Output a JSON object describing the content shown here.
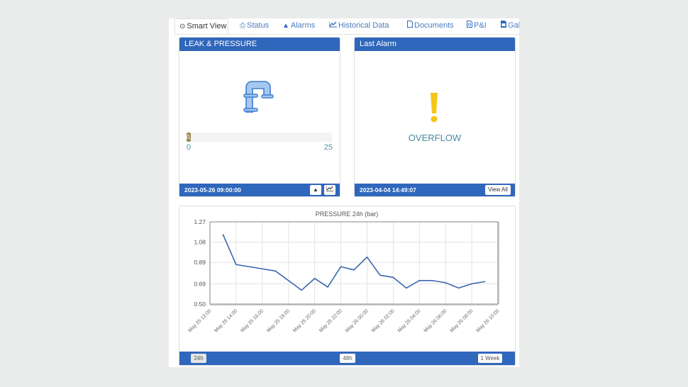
{
  "tabs": [
    {
      "label": "Smart View",
      "icon": "clock-icon",
      "glyph": "⊙",
      "active": true
    },
    {
      "label": "Status",
      "icon": "printer-icon",
      "glyph": "⎙",
      "active": false
    },
    {
      "label": "Alarms",
      "icon": "warning-icon",
      "glyph": "▲",
      "active": false
    },
    {
      "label": "Historical Data",
      "icon": "line-chart-icon",
      "glyph": "📈",
      "active": false
    },
    {
      "label": "Documents",
      "icon": "file-icon",
      "glyph": "🗋",
      "active": false
    },
    {
      "label": "P&I",
      "icon": "pdf-file-icon",
      "glyph": "🗎",
      "active": false
    },
    {
      "label": "Galle",
      "icon": "image-file-icon",
      "glyph": "🖻",
      "active": false
    }
  ],
  "leak_panel": {
    "title": "LEAK & PRESSURE",
    "icon": "pipe-icon",
    "bar": {
      "value": 0.71,
      "value_label": "0.71",
      "min": 0,
      "max": 25,
      "min_label": "0",
      "max_label": "25"
    },
    "timestamp": "2023-05-26 09:00:00",
    "buttons": [
      {
        "name": "alarm-button",
        "icon": "warning-icon",
        "glyph": "▲"
      },
      {
        "name": "chart-button",
        "icon": "line-chart-icon",
        "glyph": "⟋"
      }
    ]
  },
  "alarm_panel": {
    "title": "Last Alarm",
    "icon": "exclamation-icon",
    "alarm_text": "OVERFLOW",
    "timestamp": "2023-04-04 14:49:07",
    "view_all_label": "View All"
  },
  "range_buttons": [
    {
      "label": "24h",
      "active": true
    },
    {
      "label": "48h",
      "active": false
    },
    {
      "label": "1 Week",
      "active": false
    }
  ],
  "colors": {
    "accent": "#2f67bc",
    "line": "#3a66ad",
    "alarm": "#f5c518"
  },
  "chart_data": {
    "type": "line",
    "title": "PRESSURE 24h (bar)",
    "xlabel": "",
    "ylabel": "",
    "ylim": [
      0.5,
      1.27
    ],
    "yticks": [
      "0.50",
      "0.69",
      "0.89",
      "1.08",
      "1.27"
    ],
    "ytick_values": [
      0.5,
      0.69,
      0.89,
      1.08,
      1.27
    ],
    "xlim_hours": [
      0,
      22
    ],
    "xticks": [
      "May 25 12:00",
      "May 25 14:00",
      "May 25 16:00",
      "May 25 18:00",
      "May 25 20:00",
      "May 25 22:00",
      "May 26 00:00",
      "May 26 02:00",
      "May 26 04:00",
      "May 26 06:00",
      "May 26 08:00",
      "May 26 10:00"
    ],
    "grid": true,
    "series": [
      {
        "name": "Pressure",
        "x_hours": [
          1,
          2,
          5,
          7,
          8,
          9,
          10,
          11,
          12,
          13,
          14,
          15,
          16,
          17,
          18,
          19,
          20,
          21
        ],
        "x": [
          "May 25 13:00",
          "May 25 14:00",
          "May 25 17:00",
          "May 25 19:00",
          "May 25 20:00",
          "May 25 21:00",
          "May 25 22:00",
          "May 25 23:00",
          "May 26 00:00",
          "May 26 01:00",
          "May 26 02:00",
          "May 26 03:00",
          "May 26 04:00",
          "May 26 05:00",
          "May 26 06:00",
          "May 26 07:00",
          "May 26 08:00",
          "May 26 09:00"
        ],
        "values": [
          1.15,
          0.87,
          0.81,
          0.63,
          0.74,
          0.66,
          0.85,
          0.82,
          0.94,
          0.77,
          0.75,
          0.65,
          0.72,
          0.72,
          0.7,
          0.65,
          0.69,
          0.71
        ]
      }
    ]
  }
}
